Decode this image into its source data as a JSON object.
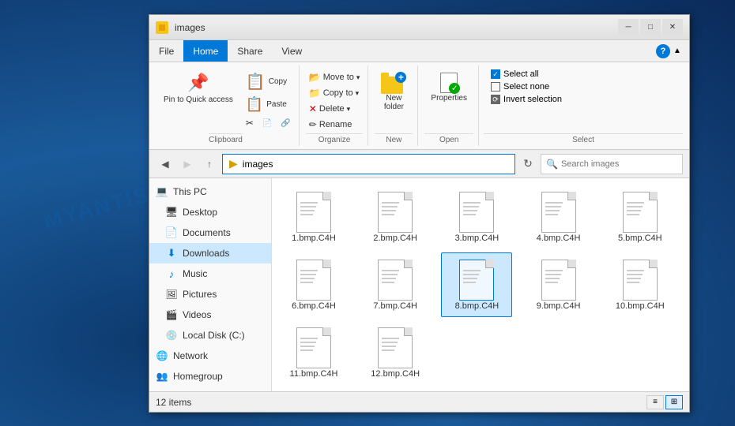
{
  "window": {
    "title": "images",
    "icon": "folder"
  },
  "titlebar": {
    "minimize": "─",
    "maximize": "□",
    "close": "✕"
  },
  "menu": {
    "items": [
      "File",
      "Home",
      "Share",
      "View"
    ],
    "active": "Home"
  },
  "ribbon": {
    "clipboard": {
      "label": "Clipboard",
      "pin_label": "Pin to Quick\naccess",
      "copy_label": "Copy",
      "paste_label": "Paste",
      "cut_label": "Cut",
      "copy_path_label": "Copy path",
      "paste_shortcut_label": "Paste shortcut"
    },
    "organize": {
      "label": "Organize",
      "move_to": "Move to",
      "copy_to": "Copy to",
      "delete": "Delete",
      "rename": "Rename"
    },
    "new": {
      "label": "New",
      "new_folder": "New\nfolder"
    },
    "open": {
      "label": "Open",
      "properties": "Properties"
    },
    "select": {
      "label": "Select",
      "select_all": "Select all",
      "select_none": "Select none",
      "invert_selection": "Invert selection"
    }
  },
  "addressbar": {
    "path": "images",
    "search_placeholder": "Search images"
  },
  "sidebar": {
    "items": [
      {
        "id": "this-pc",
        "label": "This PC",
        "icon": "pc"
      },
      {
        "id": "desktop",
        "label": "Desktop",
        "icon": "desktop"
      },
      {
        "id": "documents",
        "label": "Documents",
        "icon": "docs"
      },
      {
        "id": "downloads",
        "label": "Downloads",
        "icon": "downloads",
        "active": true
      },
      {
        "id": "music",
        "label": "Music",
        "icon": "music"
      },
      {
        "id": "pictures",
        "label": "Pictures",
        "icon": "pictures"
      },
      {
        "id": "videos",
        "label": "Videos",
        "icon": "videos"
      },
      {
        "id": "local-disk",
        "label": "Local Disk (C:)",
        "icon": "drive"
      },
      {
        "id": "network",
        "label": "Network",
        "icon": "network"
      },
      {
        "id": "homegroup",
        "label": "Homegroup",
        "icon": "homegroup"
      }
    ]
  },
  "files": [
    {
      "id": "f1",
      "name": "1.bmp.C4H",
      "selected": false
    },
    {
      "id": "f2",
      "name": "2.bmp.C4H",
      "selected": false
    },
    {
      "id": "f3",
      "name": "3.bmp.C4H",
      "selected": false
    },
    {
      "id": "f4",
      "name": "4.bmp.C4H",
      "selected": false
    },
    {
      "id": "f5",
      "name": "5.bmp.C4H",
      "selected": false
    },
    {
      "id": "f6",
      "name": "6.bmp.C4H",
      "selected": false
    },
    {
      "id": "f7",
      "name": "7.bmp.C4H",
      "selected": false
    },
    {
      "id": "f8",
      "name": "8.bmp.C4H",
      "selected": true
    },
    {
      "id": "f9",
      "name": "9.bmp.C4H",
      "selected": false
    },
    {
      "id": "f10",
      "name": "10.bmp.C4H",
      "selected": false
    },
    {
      "id": "f11",
      "name": "11.bmp.C4H",
      "selected": false
    },
    {
      "id": "f12",
      "name": "12.bmp.C4H",
      "selected": false
    }
  ],
  "statusbar": {
    "count": "12 items"
  }
}
